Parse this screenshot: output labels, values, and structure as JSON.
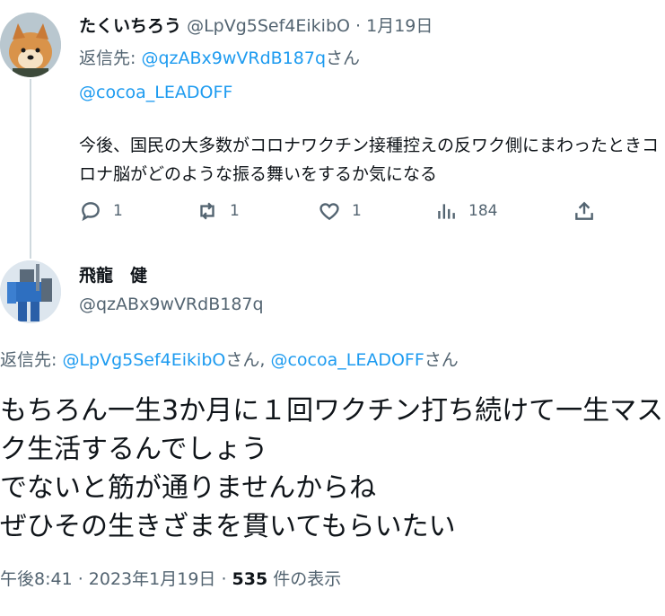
{
  "parent_tweet": {
    "display_name": "たくいちろう",
    "handle": "@LpVg5Sef4EikibO",
    "separator": "·",
    "date": "1月19日",
    "reply_label": "返信先: ",
    "reply_to": "@qzABx9wVRdB187q",
    "reply_suffix": "さん",
    "mention": "@cocoa_LEADOFF",
    "text": "今後、国民の大多数がコロナワクチン接種控えの反ワク側にまわったときコロナ脳がどのような振る舞いをするか気になる",
    "replies": "1",
    "retweets": "1",
    "likes": "1",
    "views": "184"
  },
  "main_tweet": {
    "display_name": "飛龍　健",
    "handle": "@qzABx9wVRdB187q",
    "reply_label": "返信先: ",
    "reply_to_1": "@LpVg5Sef4EikibO",
    "reply_suffix_1": "さん, ",
    "reply_to_2": "@cocoa_LEADOFF",
    "reply_suffix_2": "さん",
    "text": "もちろん一生3か月に１回ワクチン打ち続けて一生マスク生活するんでしょう\nでないと筋が通りませんからね\nぜひその生きざまを貫いてもらいたい",
    "time": "午後8:41 · 2023年1月19日 · ",
    "view_count": "535",
    "view_label": " 件の表示"
  },
  "colors": {
    "link": "#1d9bf0",
    "muted": "#536471",
    "text": "#0f1419"
  }
}
